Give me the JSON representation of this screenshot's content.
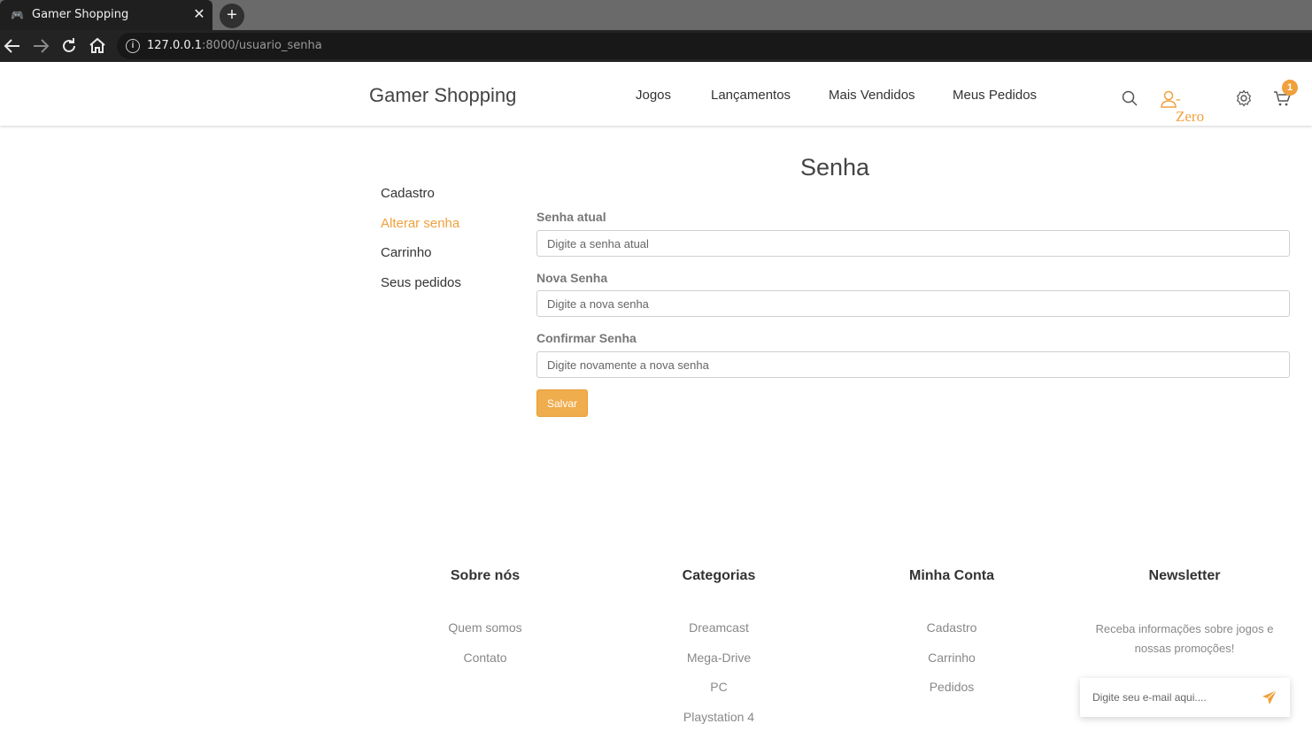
{
  "browser": {
    "tab_title": "Gamer Shopping",
    "new_tab_label": "+",
    "close_label": "✕",
    "url_host": "127.0.0.1",
    "url_rest": ":8000/usuario_senha"
  },
  "header": {
    "logo": "Gamer Shopping",
    "menu": [
      "Jogos",
      "Lançamentos",
      "Mais Vendidos",
      "Meus Pedidos"
    ],
    "user_name": "- Zero",
    "cart_count": "1",
    "icons": [
      "search-icon",
      "user-icon",
      "gear-icon",
      "cart-icon"
    ],
    "accent_color": "#f0a03c"
  },
  "sidebar": {
    "items": [
      {
        "label": "Cadastro",
        "active": false
      },
      {
        "label": "Alterar senha",
        "active": true
      },
      {
        "label": "Carrinho",
        "active": false
      },
      {
        "label": "Seus pedidos",
        "active": false
      }
    ]
  },
  "form": {
    "title": "Senha",
    "fields": [
      {
        "label": "Senha atual",
        "placeholder": "Digite a senha atual",
        "value": ""
      },
      {
        "label": "Nova Senha",
        "placeholder": "Digite a nova senha",
        "value": ""
      },
      {
        "label": "Confirmar Senha",
        "placeholder": "Digite novamente a nova senha",
        "value": ""
      }
    ],
    "submit_label": "Salvar",
    "button_color": "#f0ad4e"
  },
  "footer": {
    "columns": [
      {
        "title": "Sobre nós",
        "links": [
          "Quem somos",
          "Contato"
        ]
      },
      {
        "title": "Categorias",
        "links": [
          "Dreamcast",
          "Mega-Drive",
          "PC",
          "Playstation 4"
        ]
      },
      {
        "title": "Minha Conta",
        "links": [
          "Cadastro",
          "Carrinho",
          "Pedidos"
        ]
      },
      {
        "title": "Newsletter",
        "links": []
      }
    ],
    "newsletter_text": "Receba informações sobre jogos e nossas promoções!",
    "newsletter_placeholder": "Digite seu e-mail aqui....",
    "send_icon": "paper-plane-icon"
  }
}
